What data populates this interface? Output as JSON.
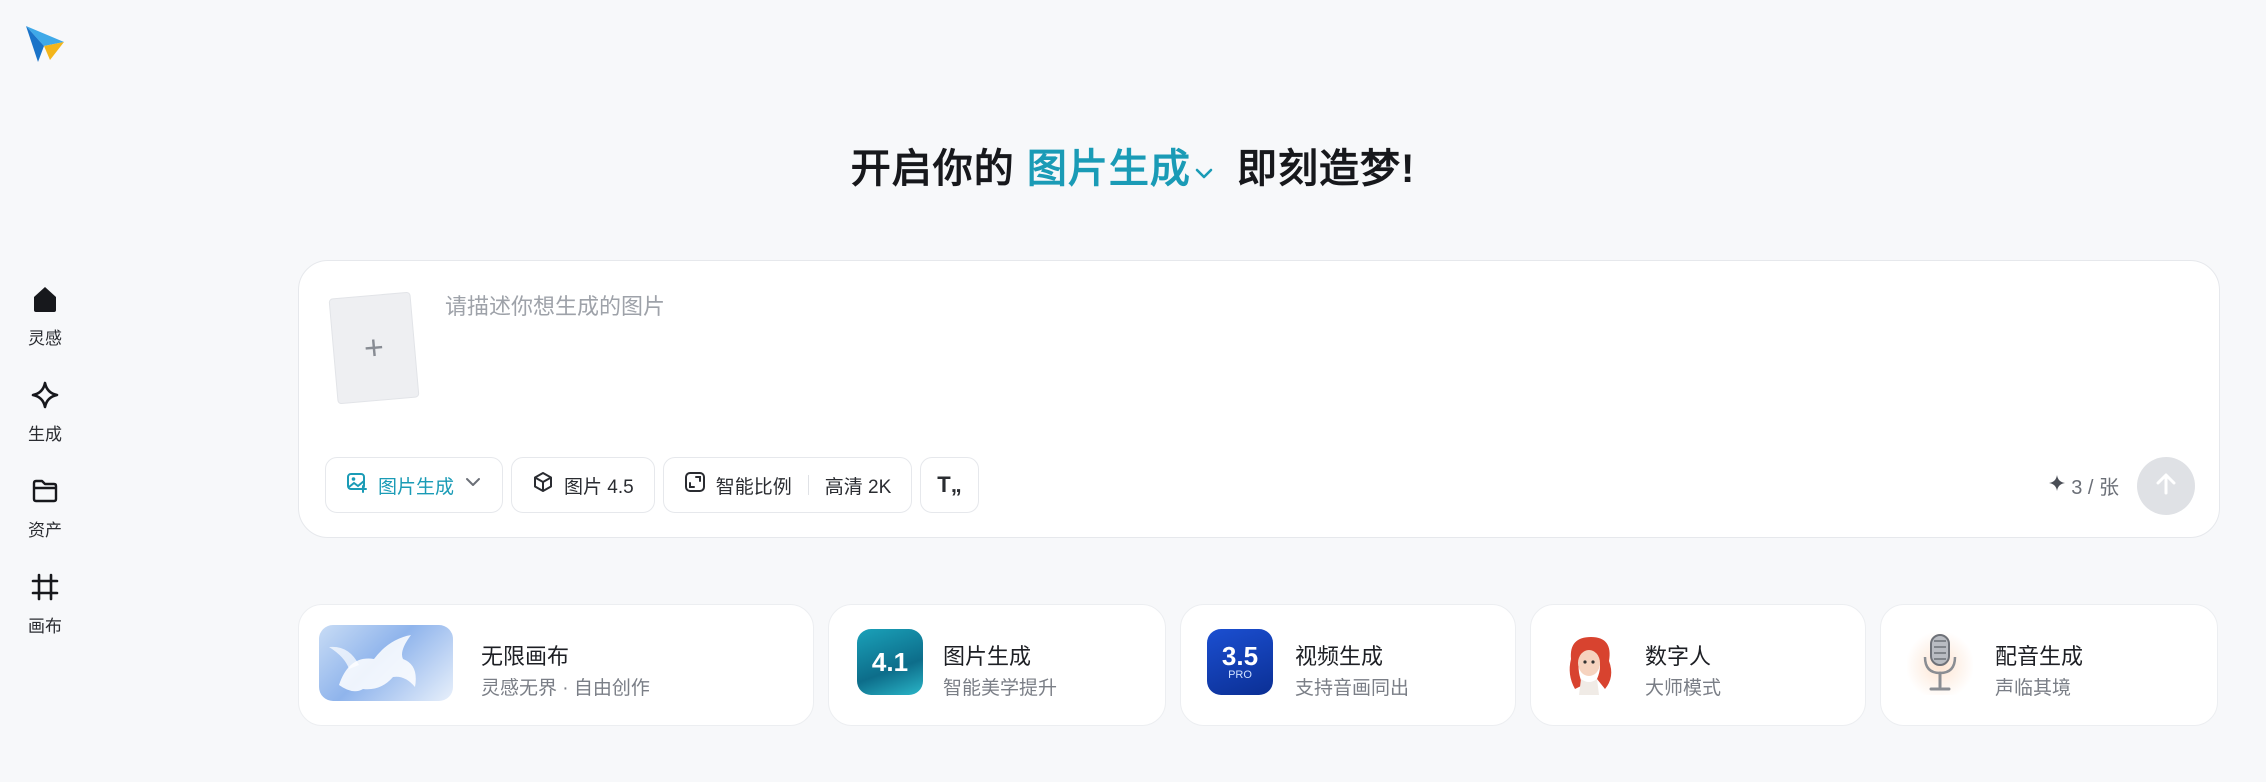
{
  "sidebar": {
    "items": [
      {
        "label": "灵感",
        "icon": "home-icon"
      },
      {
        "label": "生成",
        "icon": "sparkle-diamond-icon"
      },
      {
        "label": "资产",
        "icon": "folder-icon"
      },
      {
        "label": "画布",
        "icon": "canvas-frame-icon"
      }
    ]
  },
  "headline": {
    "prefix": "开启你的",
    "mode": "图片生成",
    "suffix": "即刻造梦!"
  },
  "composer": {
    "upload_symbol": "+",
    "placeholder": "请描述你想生成的图片",
    "value": "",
    "mode_label": "图片生成",
    "model_label": "图片 4.5",
    "ratio_label": "智能比例",
    "quality_label": "高清 2K",
    "text_style_symbol": "T„",
    "credits": "3 / 张"
  },
  "features": [
    {
      "title": "无限画布",
      "subtitle": "灵感无界 · 自由创作",
      "badge": ""
    },
    {
      "title": "图片生成",
      "subtitle": "智能美学提升",
      "badge": "4.1"
    },
    {
      "title": "视频生成",
      "subtitle": "支持音画同出",
      "badge": "3.5",
      "badge_sub": "PRO"
    },
    {
      "title": "数字人",
      "subtitle": "大师模式",
      "badge": ""
    },
    {
      "title": "配音生成",
      "subtitle": "声临其境",
      "badge": ""
    }
  ],
  "colors": {
    "accent": "#1a9bb6",
    "background": "#f7f8fa",
    "send_disabled": "#dfe1e5"
  }
}
